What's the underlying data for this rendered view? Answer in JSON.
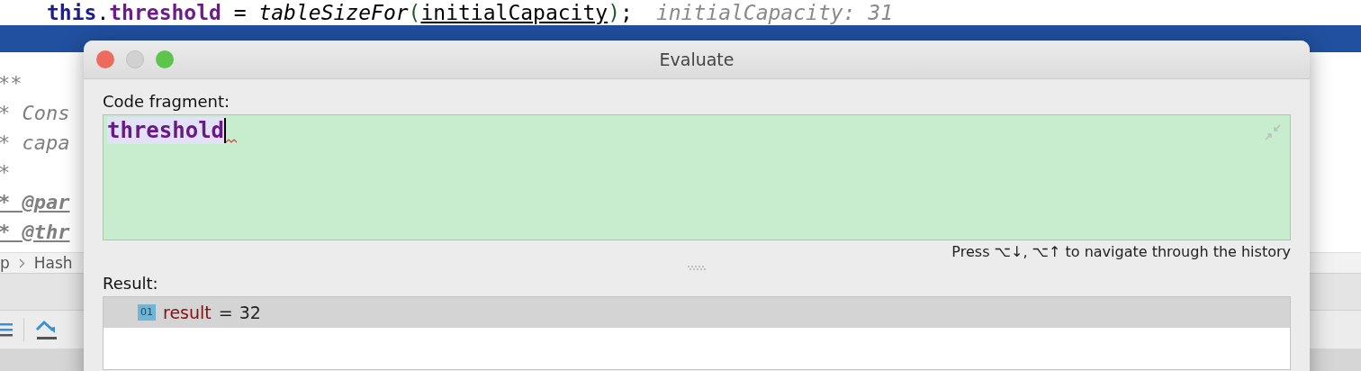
{
  "editor": {
    "code_line": [
      {
        "kind": "keyword",
        "text": "this"
      },
      {
        "kind": "plain",
        "text": "."
      },
      {
        "kind": "field",
        "text": "threshold"
      },
      {
        "kind": "plain",
        "text": " = "
      },
      {
        "kind": "method",
        "text": "tableSizeFor"
      },
      {
        "kind": "paren",
        "text": "("
      },
      {
        "kind": "param",
        "text": "initialCapacity"
      },
      {
        "kind": "paren",
        "text": ")"
      },
      {
        "kind": "plain",
        "text": ";"
      }
    ],
    "inline_hint": "initialCapacity: 31",
    "comment_lines": [
      {
        "kind": "plain",
        "text": "**"
      },
      {
        "kind": "plain",
        "text": "* Cons"
      },
      {
        "kind": "plain",
        "text": "* capa"
      },
      {
        "kind": "plain",
        "text": "*"
      },
      {
        "kind": "tag",
        "text": "* @par"
      },
      {
        "kind": "tag",
        "text": "* @thr"
      }
    ],
    "breadcrumb": [
      "p",
      "Hash"
    ]
  },
  "dialog": {
    "title": "Evaluate",
    "code_fragment_label": "Code fragment:",
    "code_fragment_value": "threshold",
    "history_hint": "Press ⌥↓, ⌥↑ to navigate through the history",
    "result_label": "Result:",
    "result_rows": [
      {
        "type_badge": "01",
        "name": "result",
        "operator": "=",
        "value": "32",
        "selected": true
      }
    ]
  }
}
